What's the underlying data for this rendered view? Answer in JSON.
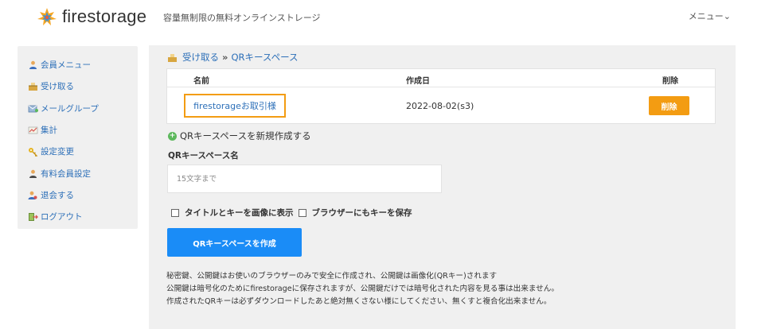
{
  "header": {
    "logo_text": "firestorage",
    "tagline": "容量無制限の無料オンラインストレージ",
    "menu_label": "メニュー",
    "menu_caret": "⌄"
  },
  "sidebar": {
    "items": [
      {
        "label": "会員メニュー",
        "icon": "user-icon"
      },
      {
        "label": "受け取る",
        "icon": "receive-icon"
      },
      {
        "label": "メールグループ",
        "icon": "mail-group-icon"
      },
      {
        "label": "集計",
        "icon": "chart-icon"
      },
      {
        "label": "設定変更",
        "icon": "key-settings-icon"
      },
      {
        "label": "有料会員設定",
        "icon": "user-icon"
      },
      {
        "label": "退会する",
        "icon": "user-remove-icon"
      },
      {
        "label": "ログアウト",
        "icon": "logout-icon"
      }
    ]
  },
  "breadcrumb": {
    "parent": "受け取る",
    "separator": "»",
    "current": "QRキースペース"
  },
  "table": {
    "headers": {
      "name": "名前",
      "created": "作成日",
      "delete": "削除"
    },
    "rows": [
      {
        "name": "firestorageお取引様",
        "created": "2022-08-02(s3)",
        "delete_label": "削除"
      }
    ]
  },
  "form": {
    "new_link": "QRキースペースを新規作成する",
    "plus_symbol": "+",
    "name_label": "QRキースペース名",
    "name_placeholder": "15文字まで",
    "checkbox_title": "タイトルとキーを画像に表示",
    "checkbox_browser": "ブラウザーにもキーを保存",
    "create_button": "QRキースペースを作成"
  },
  "notes": [
    "秘密鍵、公開鍵はお使いのブラウザーのみで安全に作成され、公開鍵は画像化(QRキー)されます",
    "公開鍵は暗号化のためにfirestorageに保存されますが、公開鍵だけでは暗号化された内容を見る事は出来ません。",
    "作成されたQRキーは必ずダウンロードしたあと絶対無くさない様にしてください、無くすと複合化出来ません。"
  ],
  "colors": {
    "accent_orange": "#f39c12",
    "primary_blue": "#1a8cf7",
    "link_blue": "#2c6fb8",
    "panel_gray": "#f0f0f0"
  }
}
